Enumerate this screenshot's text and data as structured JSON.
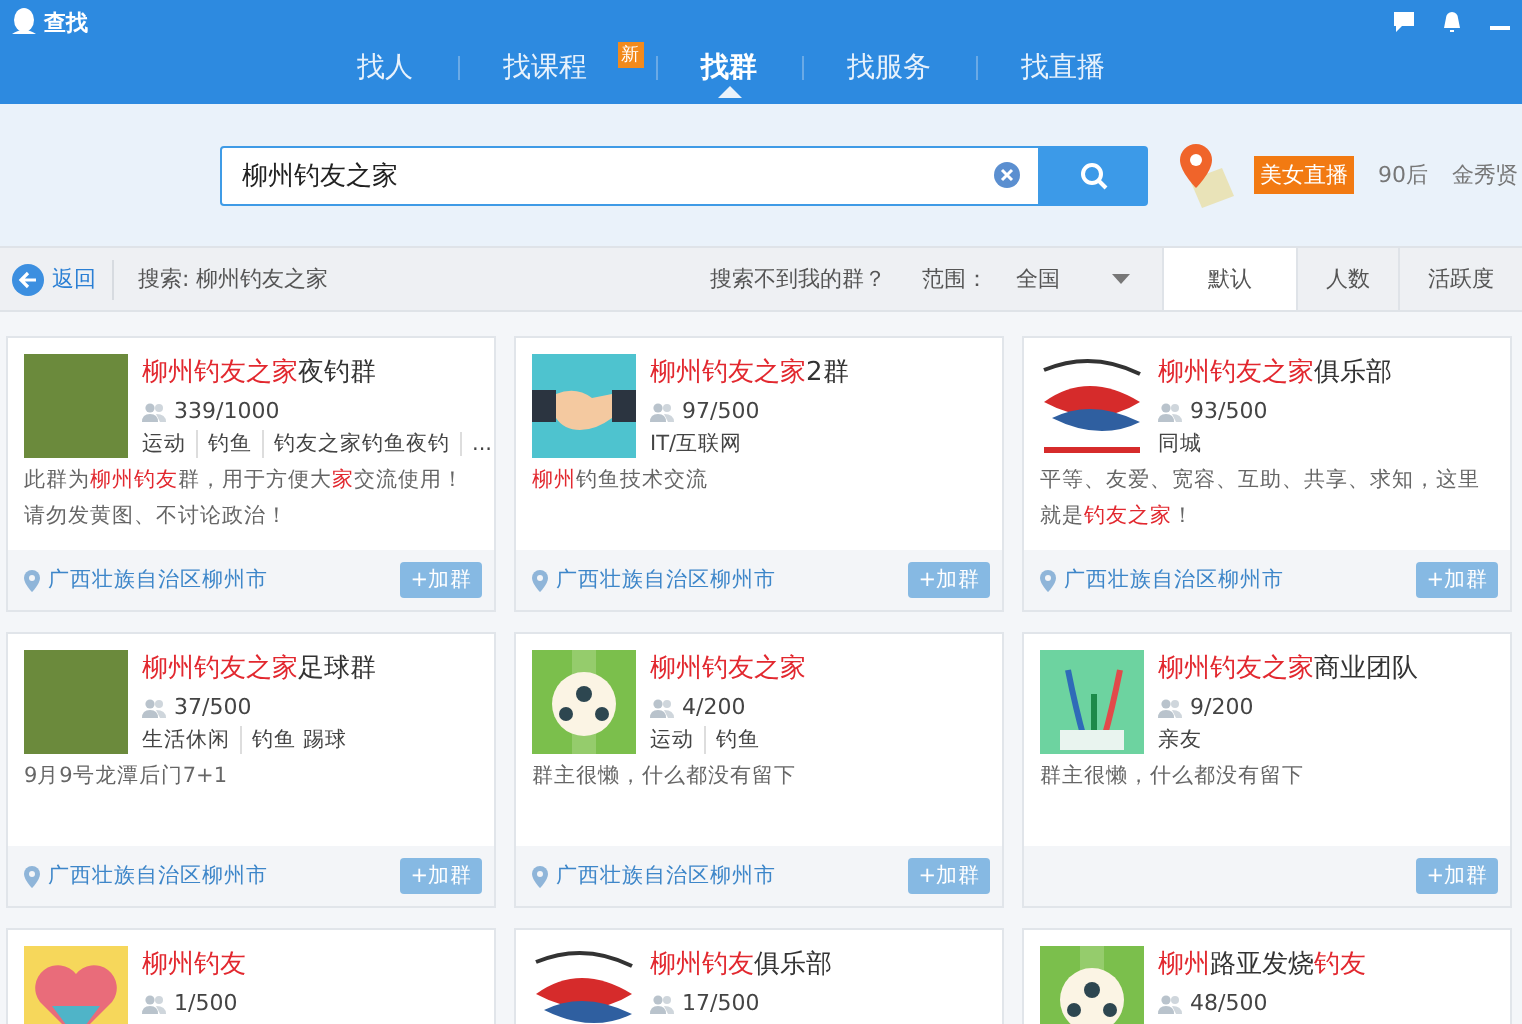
{
  "window": {
    "title": "查找"
  },
  "nav_tabs": [
    {
      "label": "找人",
      "selected": false
    },
    {
      "label": "找课程",
      "selected": false,
      "badge": "新"
    },
    {
      "label": "找群",
      "selected": true
    },
    {
      "label": "找服务",
      "selected": false
    },
    {
      "label": "找直播",
      "selected": false
    }
  ],
  "search": {
    "value": "柳州钓友之家"
  },
  "hot_words": [
    {
      "label": "美女直播",
      "kind": "badge"
    },
    {
      "label": "90后",
      "kind": "plain"
    },
    {
      "label": "金秀贤",
      "kind": "plain"
    }
  ],
  "toolbar": {
    "back": "返回",
    "query": "搜索: 柳州钓友之家",
    "help_link": "搜索不到我的群？",
    "range_label": "范围：",
    "range_value": "全国"
  },
  "sort_tabs": [
    {
      "label": "默认",
      "selected": true
    },
    {
      "label": "人数",
      "selected": false
    },
    {
      "label": "活跃度",
      "selected": false
    }
  ],
  "groups": [
    {
      "kind": "photo",
      "title": [
        {
          "text": "柳州钓友之家",
          "highlight": true
        },
        {
          "text": "夜钓群",
          "highlight": false
        }
      ],
      "members": "339/1000",
      "tags": [
        "运动",
        "钓鱼",
        "钓友之家钓鱼夜钓",
        "..."
      ],
      "description": [
        {
          "text": "此群为",
          "highlight": false
        },
        {
          "text": "柳州钓友",
          "highlight": true
        },
        {
          "text": "群，用于方便大",
          "highlight": false
        },
        {
          "text": "家",
          "highlight": true
        },
        {
          "text": "交流使用！请勿发黄图、不讨论政治！",
          "highlight": false
        }
      ],
      "location": "广西壮族自治区柳州市",
      "join": "+加群"
    },
    {
      "kind": "handshake",
      "title": [
        {
          "text": "柳州钓友之家",
          "highlight": true
        },
        {
          "text": "2群",
          "highlight": false
        }
      ],
      "members": "97/500",
      "tags": [
        "IT/互联网"
      ],
      "description": [
        {
          "text": "柳州",
          "highlight": true
        },
        {
          "text": "钓鱼技术交流",
          "highlight": false
        }
      ],
      "location": "广西壮族自治区柳州市",
      "join": "+加群"
    },
    {
      "kind": "fish",
      "title": [
        {
          "text": "柳州钓友之家",
          "highlight": true
        },
        {
          "text": "俱乐部",
          "highlight": false
        }
      ],
      "members": "93/500",
      "tags": [
        "同城"
      ],
      "description": [
        {
          "text": "平等、友爱、宽容、互助、共享、求知，这里就是",
          "highlight": false
        },
        {
          "text": "钓友之家",
          "highlight": true
        },
        {
          "text": "！",
          "highlight": false
        }
      ],
      "location": "广西壮族自治区柳州市",
      "join": "+加群"
    },
    {
      "kind": "photo",
      "title": [
        {
          "text": "柳州钓友之家",
          "highlight": true
        },
        {
          "text": "足球群",
          "highlight": false
        }
      ],
      "members": "37/500",
      "tags": [
        "生活休闲",
        "钓鱼 踢球"
      ],
      "description": [
        {
          "text": "9月9号龙潭后门7+1",
          "highlight": false
        }
      ],
      "location": "广西壮族自治区柳州市",
      "join": "+加群"
    },
    {
      "kind": "ball",
      "title": [
        {
          "text": "柳州钓友之家",
          "highlight": true
        }
      ],
      "members": "4/200",
      "tags": [
        "运动",
        "钓鱼"
      ],
      "description": [
        {
          "text": "群主很懒，什么都没有留下",
          "highlight": false
        }
      ],
      "location": "广西壮族自治区柳州市",
      "join": "+加群"
    },
    {
      "kind": "toothbrush",
      "title": [
        {
          "text": "柳州钓友之家",
          "highlight": true
        },
        {
          "text": "商业团队",
          "highlight": false
        }
      ],
      "members": "9/200",
      "tags": [
        "亲友"
      ],
      "description": [
        {
          "text": "群主很懒，什么都没有留下",
          "highlight": false
        }
      ],
      "join": "+加群"
    },
    {
      "kind": "heart",
      "title": [
        {
          "text": "柳州钓友",
          "highlight": true
        }
      ],
      "members": "1/500"
    },
    {
      "kind": "fish",
      "title": [
        {
          "text": "柳州钓友",
          "highlight": true
        },
        {
          "text": "俱乐部",
          "highlight": false
        }
      ],
      "members": "17/500"
    },
    {
      "kind": "ball",
      "title": [
        {
          "text": "柳州",
          "highlight": true
        },
        {
          "text": "路亚发烧",
          "highlight": false
        },
        {
          "text": "钓友",
          "highlight": true
        }
      ],
      "members": "48/500"
    }
  ]
}
